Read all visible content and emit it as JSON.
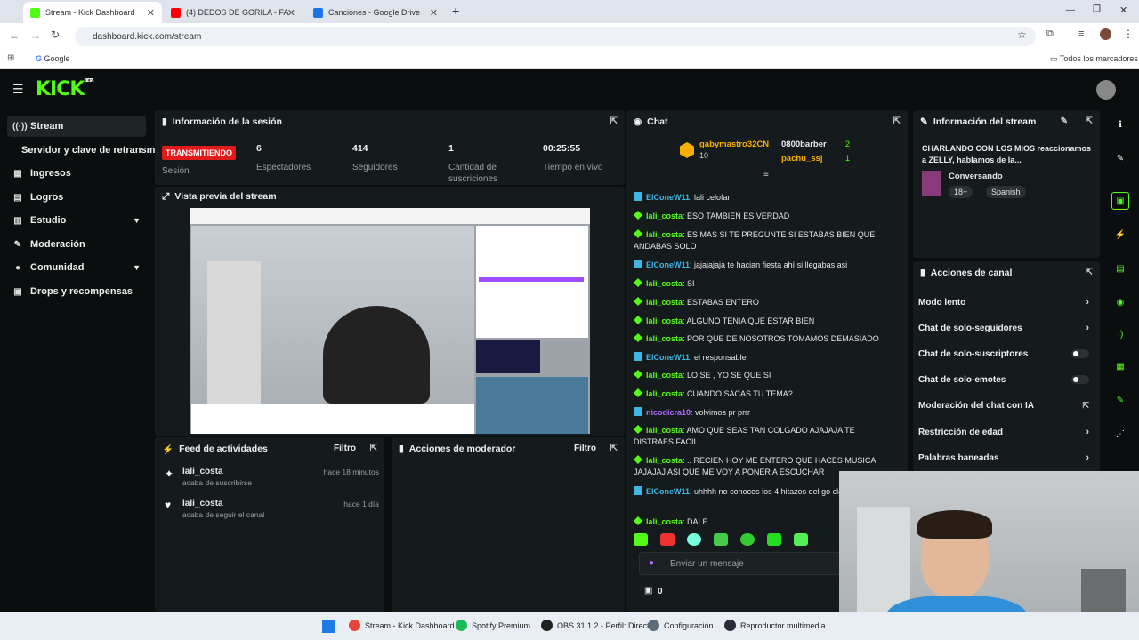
{
  "browser": {
    "tabs": [
      {
        "label": "Stream - Kick Dashboard",
        "color": "#53fc18"
      },
      {
        "label": "(4) DEDOS DE GORILA - FA",
        "color": "#ff0000"
      },
      {
        "label": "Canciones - Google Drive",
        "color": "#1a73e8"
      }
    ],
    "url": "dashboard.kick.com/stream",
    "bookmark": "Google",
    "all_bookmarks": "Todos los marcadores"
  },
  "sidebar": {
    "items": [
      {
        "label": "Stream",
        "icon": "broadcast-icon"
      },
      {
        "label": "Servidor y clave de retransmisión",
        "icon": ""
      },
      {
        "label": "Ingresos",
        "icon": "money-icon"
      },
      {
        "label": "Logros",
        "icon": "trophy-icon"
      },
      {
        "label": "Estudio",
        "icon": "studio-icon"
      },
      {
        "label": "Moderación",
        "icon": "wrench-icon"
      },
      {
        "label": "Comunidad",
        "icon": "community-icon"
      },
      {
        "label": "Drops y recompensas",
        "icon": "gift-icon"
      }
    ]
  },
  "session": {
    "title": "Información de la sesión",
    "live_badge": "TRANSMITIENDO",
    "session_label": "Sesión",
    "stats": [
      {
        "value": "6",
        "label": "Espectadores"
      },
      {
        "value": "414",
        "label": "Seguidores"
      },
      {
        "value": "1",
        "label": "Cantidad de suscriciones"
      },
      {
        "value": "00:25:55",
        "label": "Tiempo en vivo"
      }
    ]
  },
  "preview": {
    "title": "Vista previa del stream"
  },
  "activity": {
    "title": "Feed de actividades",
    "filter": "Filtro",
    "items": [
      {
        "user": "lali_costa",
        "action": "acaba de suscribirse",
        "time": "hace 18 minutos"
      },
      {
        "user": "lali_costa",
        "action": "acaba de seguir el canal",
        "time": "hace 1 día"
      }
    ]
  },
  "modactions": {
    "title": "Acciones de moderador",
    "filter": "Filtro"
  },
  "chat": {
    "title": "Chat",
    "top": {
      "gifter": "gabymastro32CN",
      "gifter_count": "10",
      "others": [
        {
          "name": "0800barber",
          "count": "2"
        },
        {
          "name": "pachu_ssj",
          "count": "1"
        }
      ]
    },
    "messages": [
      {
        "user": "ElConeW11",
        "text": "lali celofan",
        "kind": "b"
      },
      {
        "user": "lali_costa",
        "text": "ESO TAMBIEN ES VERDAD",
        "kind": "g"
      },
      {
        "user": "lali_costa",
        "text": "ES MAS SI TE PREGUNTE SI ESTABAS BIEN QUE ANDABAS SOLO",
        "kind": "g"
      },
      {
        "user": "ElConeW11",
        "text": "jajajajaja te hacian fiesta ahí si llegabas asi",
        "kind": "b"
      },
      {
        "user": "lali_costa",
        "text": "SI",
        "kind": "g"
      },
      {
        "user": "lali_costa",
        "text": "ESTABAS ENTERO",
        "kind": "g"
      },
      {
        "user": "lali_costa",
        "text": "ALGUNO TENIA QUE ESTAR BIEN",
        "kind": "g"
      },
      {
        "user": "lali_costa",
        "text": "POR QUE DE NOSOTROS TOMAMOS DEMASIADO",
        "kind": "g"
      },
      {
        "user": "ElConeW11",
        "text": "el responsable",
        "kind": "b"
      },
      {
        "user": "lali_costa",
        "text": "LO SE , YO SE QUE SI",
        "kind": "g"
      },
      {
        "user": "lali_costa",
        "text": "CUANDO SACAS TU TEMA?",
        "kind": "g"
      },
      {
        "user": "nicodicra10",
        "text": "volvimos pr prrr",
        "kind": "p"
      },
      {
        "user": "lali_costa",
        "text": "AMO QUE SEAS TAN COLGADO AJAJAJA TE DISTRAES FACIL",
        "kind": "g"
      },
      {
        "user": "lali_costa",
        "text": ".. RECIEN HOY ME ENTERO QUE HACES MUSICA JAJAJAJ ASI QUE ME VOY A PONER A ESCUCHAR",
        "kind": "g"
      },
      {
        "user": "ElConeW11",
        "text": "uhhhh no conoces los 4 hitazos del go claros Lali?",
        "kind": "b"
      },
      {
        "user": "lali_costa",
        "text": "DALE",
        "kind": "g"
      }
    ],
    "input_placeholder": "Enviar un mensaje",
    "points": "0"
  },
  "stream_info": {
    "title": "Información del stream",
    "stream_title": "CHARLANDO CON LOS MIOS reaccionamos a ZELLY, hablamos de la...",
    "category": "Conversando",
    "tags": [
      "18+",
      "Spanish"
    ]
  },
  "channel_actions": {
    "title": "Acciones de canal",
    "rows": [
      {
        "label": "Modo lento",
        "type": "chevron"
      },
      {
        "label": "Chat de solo-seguidores",
        "type": "chevron"
      },
      {
        "label": "Chat de solo-suscriptores",
        "type": "toggle"
      },
      {
        "label": "Chat de solo-emotes",
        "type": "toggle"
      },
      {
        "label": "Moderación del chat con IA",
        "type": "external"
      },
      {
        "label": "Restricción de edad",
        "type": "chevron"
      },
      {
        "label": "Palabras baneadas",
        "type": "chevron"
      }
    ]
  },
  "taskbar": {
    "items": [
      {
        "label": "Stream - Kick Dashboard",
        "color": "#e8453c"
      },
      {
        "label": "Spotify Premium",
        "color": "#1db954"
      },
      {
        "label": "OBS 31.1.2 - Perfil: Direct",
        "color": "#222222"
      },
      {
        "label": "Configuración",
        "color": "#5b6b7c"
      },
      {
        "label": "Reproductor multimedia",
        "color": "#2b2b3b"
      }
    ]
  },
  "colors": {
    "accent": "#53fc18",
    "live": "#e31a1a",
    "bg": "#0b0e0f",
    "panel": "#151a1c"
  }
}
